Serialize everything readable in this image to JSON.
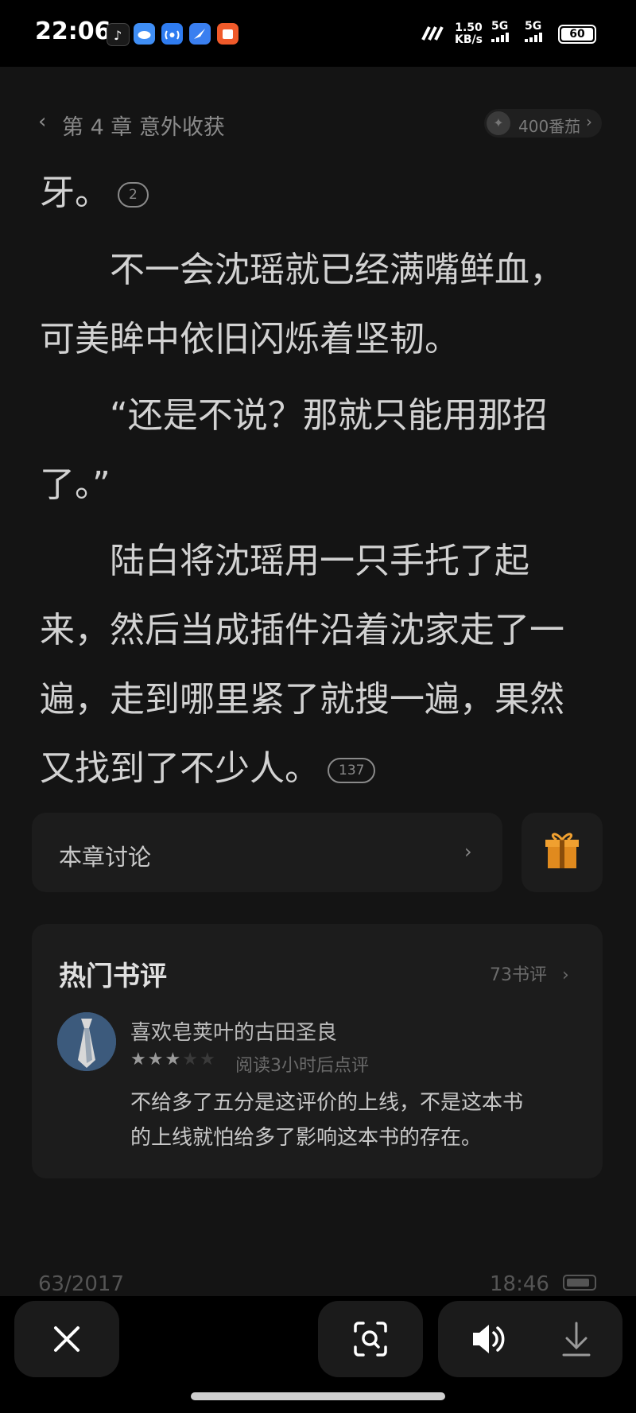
{
  "status_bar": {
    "time": "22:06",
    "net_speed_value": "1.50",
    "net_speed_unit": "KB/s",
    "sim1": "5G",
    "sim2": "5G",
    "battery": "60"
  },
  "reader": {
    "chapter_title": "第 4 章 意外收获",
    "coins": "400番茄",
    "paragraphs": [
      {
        "lines": [
          "牙。"
        ],
        "bubble": "2"
      },
      {
        "lines": [
          "　　不一会沈瑶就已经满嘴鲜血，",
          "可美眸中依旧闪烁着坚韧。"
        ]
      },
      {
        "lines": [
          "　　“还是不说？那就只能用那招",
          "了。”"
        ]
      },
      {
        "lines": [
          "　　陆白将沈瑶用一只手托了起",
          "来，然后当成插件沿着沈家走了一",
          "遍，走到哪里紧了就搜一遍，果然",
          "又找到了不少人。"
        ],
        "bubble": "137"
      }
    ],
    "discussion_label": "本章讨论",
    "hot_reviews": {
      "title": "热门书评",
      "count": "73书评",
      "review": {
        "reviewer": "喜欢皂荚叶的古田圣良",
        "rating": 3,
        "max_rating": 5,
        "time": "阅读3小时后点评",
        "text_lines": [
          "不给多了五分是这评价的上线，不是这本书",
          "的上线就怕给多了影响这本书的存在。"
        ]
      }
    },
    "page_indicator": "63/2017",
    "clock": "18:46"
  },
  "icons": {
    "close": "close-icon",
    "scan": "screen-scan-icon",
    "speaker": "speaker-icon",
    "download": "download-icon",
    "gift": "gift-icon"
  },
  "colors": {
    "background": "#141414",
    "text": "#d2d2d2",
    "gift": "#e08a1e",
    "star_on": "#9a9a9a",
    "star_off": "#3a3a3a"
  }
}
